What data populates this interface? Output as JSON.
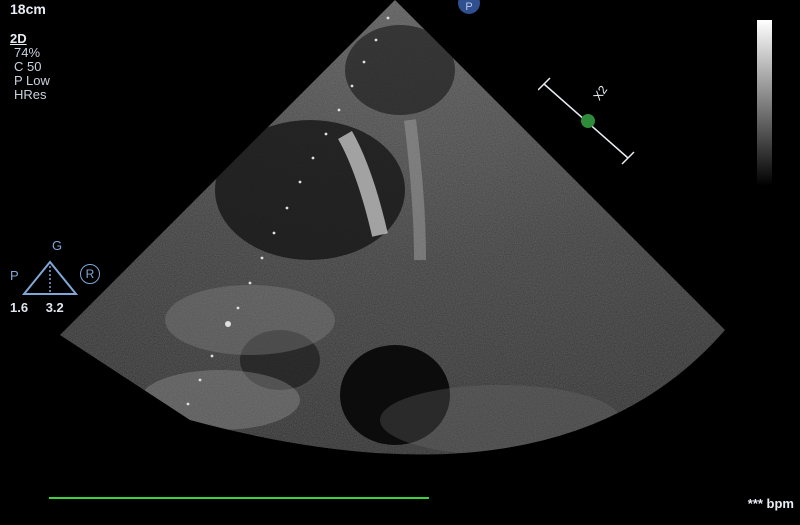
{
  "params": {
    "depth": "18cm",
    "mode": "2D",
    "lines": [
      "74%",
      "C 50",
      "P Low",
      "HRes"
    ]
  },
  "gain": {
    "top_label": "G",
    "left_label": "P",
    "right_label": "R",
    "values": [
      "1.6",
      "3.2"
    ]
  },
  "status": {
    "bpm": "*** bpm"
  },
  "badge": "P",
  "zoom": {
    "label": "X2"
  },
  "colors": {
    "ecg": "#39d439",
    "accent": "#7fa6d6",
    "zoom_handle": "#2e8b3a"
  }
}
